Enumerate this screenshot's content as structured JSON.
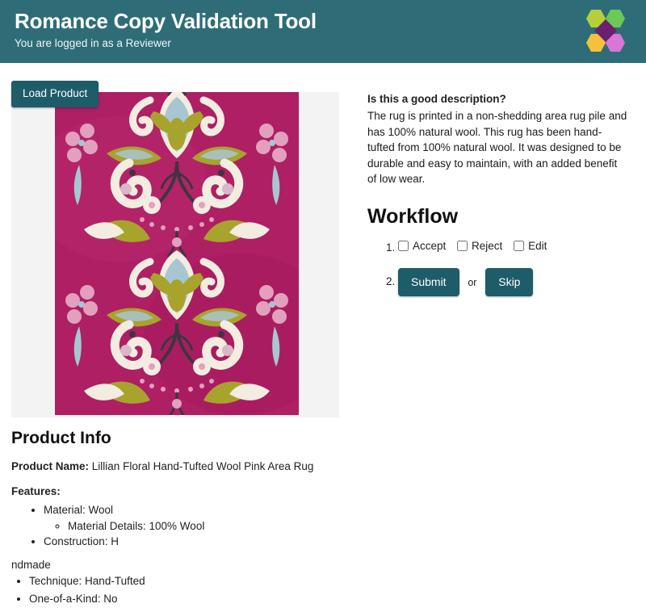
{
  "header": {
    "title": "Romance Copy Validation Tool",
    "subtitle": "You are logged in as a Reviewer",
    "background_color": "#2e6d78",
    "logo": {
      "name": "hexagon-cluster-logo",
      "colors": {
        "top_left": "#b5cf3a",
        "top_right": "#6cc857",
        "bottom_left": "#f5c13c",
        "bottom_right": "#d877d8",
        "center": "#6b1f6e"
      }
    }
  },
  "toolbar": {
    "load_product_label": "Load Product"
  },
  "product_image": {
    "alt": "Lillian Floral Hand-Tufted Wool Pink Area Rug",
    "background_color": "#f3f3f3",
    "rug_colors": {
      "field": "#ae1f63",
      "olive": "#a8a32c",
      "cream": "#f3ece0",
      "blue": "#a8c6d2",
      "vine": "#3f3540",
      "pink": "#e2a0bd"
    }
  },
  "description": {
    "question": "Is this a good description?",
    "text": "The rug is printed in a non-shedding area rug pile and has 100% natural wool. This rug has been hand-tufted from 100% natural wool. It was designed to be durable and easy to maintain, with an added benefit of low wear."
  },
  "workflow": {
    "title": "Workflow",
    "step1": {
      "number": "1.",
      "options": [
        {
          "label": "Accept",
          "checked": false
        },
        {
          "label": "Reject",
          "checked": false
        },
        {
          "label": "Edit",
          "checked": false
        }
      ]
    },
    "step2": {
      "number": "2.",
      "submit_label": "Submit",
      "or_label": "or",
      "skip_label": "Skip",
      "button_color": "#1d5c68"
    }
  },
  "product_info": {
    "title": "Product Info",
    "product_name_label": "Product Name:",
    "product_name_value": "Lillian Floral Hand-Tufted Wool Pink Area Rug",
    "features_label": "Features:",
    "features": [
      "Material: Wool",
      "Construction: H"
    ],
    "material_details": "Material Details: 100% Wool",
    "orphan_text": "ndmade",
    "features_tail": [
      "Technique: Hand-Tufted",
      "One-of-a-Kind: No"
    ]
  }
}
